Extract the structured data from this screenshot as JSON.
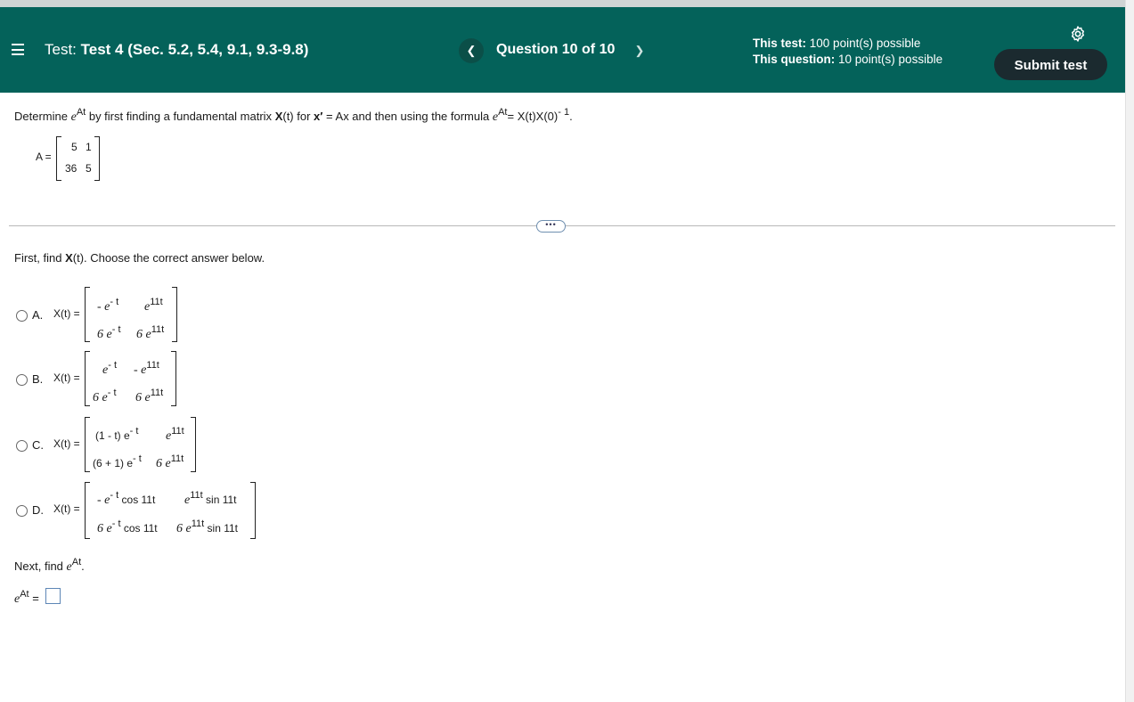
{
  "header": {
    "test_prefix": "Test:",
    "test_name": "Test 4 (Sec. 5.2, 5.4, 9.1, 9.3-9.8)",
    "question_label": "Question 10 of 10",
    "this_test_label": "This test:",
    "this_test_value": "100 point(s) possible",
    "this_question_label": "This question:",
    "this_question_value": "10 point(s) possible",
    "submit_label": "Submit test",
    "prev_icon": "chevron-left-icon",
    "next_icon": "chevron-right-icon"
  },
  "problem": {
    "determine_text": "Determine",
    "e": "e",
    "At": "At",
    "mid_text": "by first finding a fundamental matrix",
    "X_t": "X",
    "t_paren": "(t) for",
    "x_prime": "x′",
    "eq_Ax": "= Ax and then using the formula",
    "formula_rhs": "= X(t)X(0)",
    "neg_one": "- 1",
    "period": ".",
    "A_label": "A =",
    "matrix_A": [
      [
        "5",
        "1"
      ],
      [
        "36",
        "5"
      ]
    ]
  },
  "part1": {
    "prompt_pre": "First, find",
    "prompt_X": "X",
    "prompt_post": "(t). Choose the correct answer below."
  },
  "options": [
    {
      "letter": "A.",
      "label": "X(t) =",
      "r1c1": "- e",
      "r1c1s": "- t",
      "r1c2": "e",
      "r1c2s": "11t",
      "r2c1": "6 e",
      "r2c1s": "- t",
      "r2c2": "6 e",
      "r2c2s": "11t"
    },
    {
      "letter": "B.",
      "label": "X(t) =",
      "r1c1": "e",
      "r1c1s": "- t",
      "r1c2": "- e",
      "r1c2s": "11t",
      "r2c1": "6 e",
      "r2c1s": "- t",
      "r2c2": "6 e",
      "r2c2s": "11t"
    },
    {
      "letter": "C.",
      "label": "X(t) =",
      "r1c1": "(1 - t) e",
      "r1c1s": "- t",
      "r1c2": "e",
      "r1c2s": "11t",
      "r2c1": "(6 + 1) e",
      "r2c1s": "- t",
      "r2c2": "6 e",
      "r2c2s": "11t"
    },
    {
      "letter": "D.",
      "label": "X(t) =",
      "r1c1": "- e",
      "r1c1s": "- t",
      "r1c1t": "cos 11t",
      "r1c2": "e",
      "r1c2s": "11t",
      "r1c2t": "sin 11t",
      "r2c1": "6 e",
      "r2c1s": "- t",
      "r2c1t": "cos 11t",
      "r2c2": "6 e",
      "r2c2s": "11t",
      "r2c2t": "sin 11t"
    }
  ],
  "part2": {
    "next_text": "Next, find",
    "e": "e",
    "At": "At",
    "period": ".",
    "eq": "="
  },
  "more_icon": "ellipsis-icon"
}
